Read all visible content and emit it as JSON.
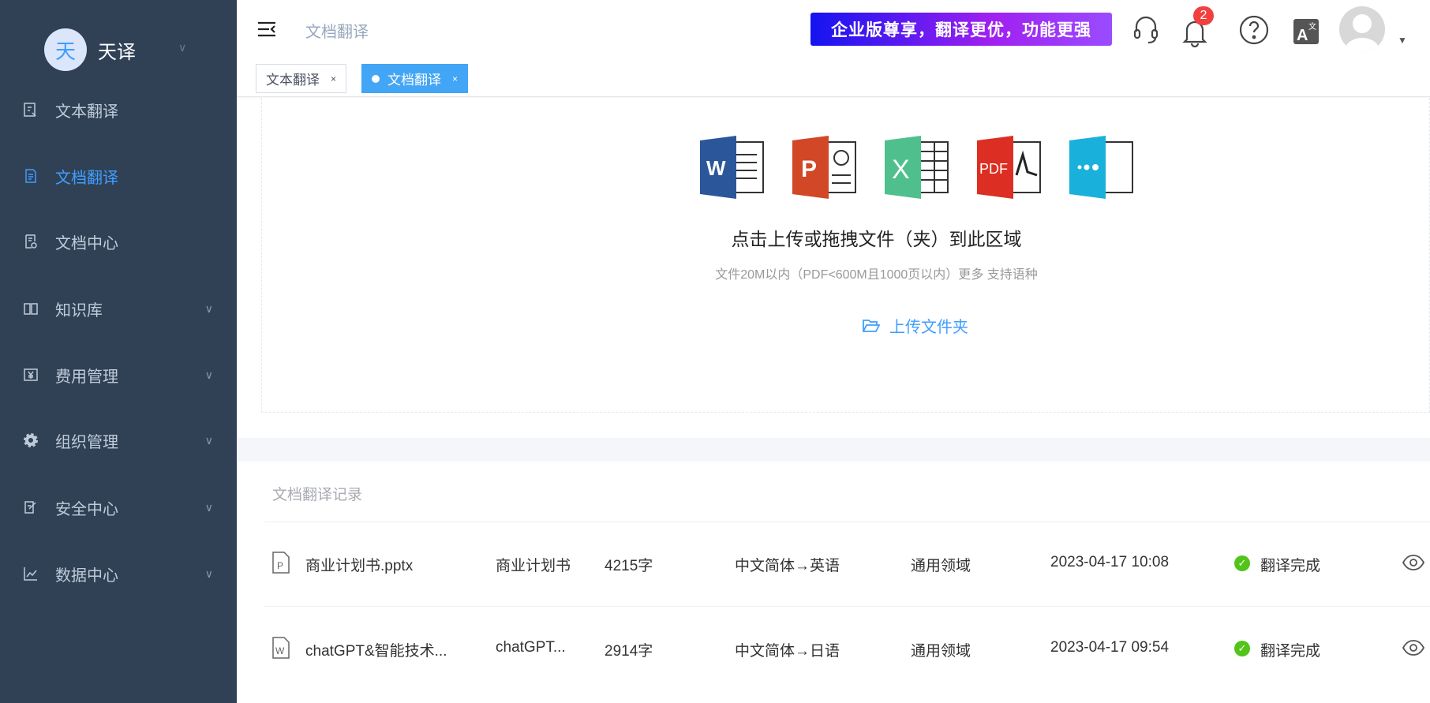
{
  "sidebar": {
    "logo_char": "天",
    "brand": "天译",
    "items": [
      {
        "label": "文本翻译",
        "icon": "text-translate-icon"
      },
      {
        "label": "文档翻译",
        "icon": "document-icon",
        "active": true
      },
      {
        "label": "文档中心",
        "icon": "document-center-icon"
      },
      {
        "label": "知识库",
        "icon": "book-icon",
        "expandable": true
      },
      {
        "label": "费用管理",
        "icon": "yen-icon",
        "expandable": true
      },
      {
        "label": "组织管理",
        "icon": "gear-icon",
        "expandable": true
      },
      {
        "label": "安全中心",
        "icon": "security-icon",
        "expandable": true
      },
      {
        "label": "数据中心",
        "icon": "chart-icon",
        "expandable": true
      }
    ]
  },
  "header": {
    "breadcrumb": "文档翻译",
    "banner": "企业版尊享，翻译更优，功能更强",
    "notification_count": "2"
  },
  "tabs": [
    {
      "label": "文本翻译",
      "close": "×"
    },
    {
      "label": "文档翻译",
      "close": "×",
      "active": true
    }
  ],
  "upload": {
    "title": "点击上传或拖拽文件（夹）到此区域",
    "subtitle": "文件20M以内（PDF<600M且1000页以内）更多  支持语种",
    "folder_button": "上传文件夹",
    "file_types": [
      "W",
      "P",
      "X",
      "PDF",
      "..."
    ]
  },
  "records": {
    "title": "文档翻译记录",
    "rows": [
      {
        "type": "P",
        "name": "商业计划书.pptx",
        "title": "商业计划书",
        "words": "4215字",
        "lang": "中文简体→英语",
        "domain": "通用领域",
        "time": "2023-04-17 10:08",
        "status": "翻译完成"
      },
      {
        "type": "W",
        "name": "chatGPT&智能技术...",
        "title": "chatGPT...",
        "words": "2914字",
        "lang": "中文简体→日语",
        "domain": "通用领域",
        "time": "2023-04-17 09:54",
        "status": "翻译完成"
      }
    ]
  },
  "colors": {
    "sidebar": "#304156",
    "accent": "#409eff",
    "success": "#52c41a",
    "badge": "#f24040"
  }
}
